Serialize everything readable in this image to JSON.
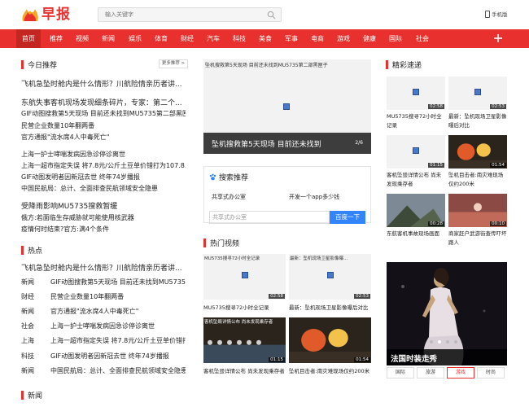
{
  "header": {
    "logo_text": "早报",
    "search_placeholder": "输入关键字",
    "mobile_label": "手机版"
  },
  "nav": {
    "items": [
      "首页",
      "推荐",
      "视频",
      "新闻",
      "娱乐",
      "体育",
      "财经",
      "汽车",
      "科技",
      "美食",
      "军事",
      "电商",
      "游戏",
      "健康",
      "国际",
      "社会"
    ],
    "active_index": 0,
    "accent": "#e8312e"
  },
  "today": {
    "title": "今日推荐",
    "more": "更多推荐 >",
    "items": [
      "飞机急坠时舱内是什么情形？川航险情亲历者讲...",
      "东航失事客机现场发现细条碎片，专家：第二个...",
      "GIF动图搜救第5天现场 目前还未找到MU5735第二部黑匣子",
      "民营企业数量10年翻两番",
      "官方通报\"流水席4人中毒死亡\"",
      "上海一护士哮喘发病因急诊停诊离世",
      "上海一超市指定失误 将7.8元/公斤土豆单价错打为107.8...",
      "GIF动图发明者因新冠去世 终年74岁播报",
      "中国民航局：总计、全面排查民航领域安全隐患",
      "受降雨影响MU5735搜救暂缓",
      "俄方:若面临生存威胁就可能使用核武器",
      "疫情何时结束?官方:满4个条件"
    ]
  },
  "hot": {
    "title": "热点",
    "headline": "飞机急坠时舱内是什么情形？川航险情亲历者讲...",
    "rows": [
      {
        "cat": "新闻",
        "text": "GIF动图搜救第5天现场 目前还未找到MU5735第二部黑匣子"
      },
      {
        "cat": "财经",
        "text": "民营企业数量10年翻两番"
      },
      {
        "cat": "新闻",
        "text": "官方通报\"流水席4人中毒死亡\""
      },
      {
        "cat": "社会",
        "text": "上海一护士哮喘发病因急诊停诊离世"
      },
      {
        "cat": "上海",
        "text": "上海一超市指定失误 将7.8元/公斤土豆单价错打为107..."
      },
      {
        "cat": "科技",
        "text": "GIF动图发明者因新冠去世 终年74岁播报"
      },
      {
        "cat": "新闻",
        "text": "中国民航局：总计、全面排查民航领域安全隐患"
      }
    ]
  },
  "news_title": "新闻",
  "slider": {
    "top_text": "坠机搜救第5天现场 目前还未找到MU5735第二部黑匣子",
    "caption": "坠机搜救第5天现场 目前还未找到",
    "counter": "2/6"
  },
  "baidu": {
    "title": "搜索推荐",
    "link1": "共享式办公室",
    "link2": "开发一个app多少钱",
    "input": "共享式办公室",
    "button": "百度一下"
  },
  "video": {
    "title": "热门视频",
    "cards": [
      {
        "tag": "MU5735搜寻72小时全记录",
        "time": "02:58",
        "caption": "MU5735搜寻72小时全记录"
      },
      {
        "tag": "最新：坠机现场卫星影像曝...",
        "time": "02:53",
        "caption": "最新：坠机现场卫星影像曝后对比"
      },
      {
        "tag": "客机坠毁详情公布 尚未发现乘存者",
        "time": "01:15",
        "caption": "客机坠毁详情公布 尚未发现乘存者"
      },
      {
        "tag": "",
        "time": "01:54",
        "caption": "坠机目击者:南灾难现场仅约200米"
      }
    ]
  },
  "quick": {
    "title": "精彩速递",
    "cards": [
      {
        "time": "02:58",
        "caption": "MU5735搜寻72小时全记录"
      },
      {
        "time": "02:53",
        "caption": "最新：坠机现场卫星影像曝后对比"
      },
      {
        "time": "01:15",
        "caption": "客机坠毁详情公布 尚未发现乘存者"
      },
      {
        "time": "01:54",
        "caption": "坠机目击者:南灾难现场仅约200米"
      },
      {
        "time": "00:28",
        "caption": "东航客机事故现场画面"
      },
      {
        "time": "00:10",
        "caption": "商家赶户武游街查传吓坏路人"
      }
    ]
  },
  "feature": {
    "caption": "法国时装走秀"
  },
  "tabs": [
    "国际",
    "旅游",
    "游戏",
    "时尚"
  ],
  "tabs_active": 2
}
